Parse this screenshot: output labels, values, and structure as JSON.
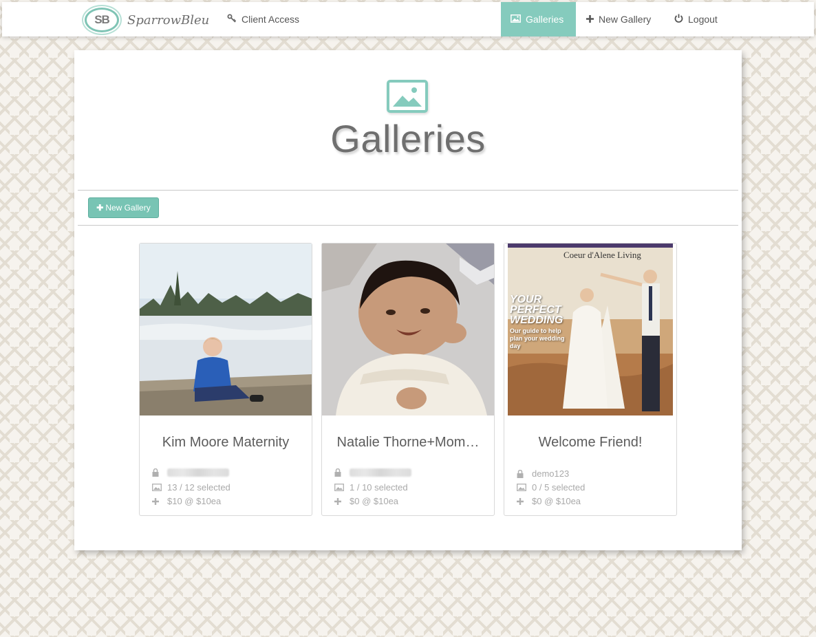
{
  "brand": {
    "initials": "SB",
    "name": "SparrowBleu"
  },
  "nav": {
    "client_access": "Client Access",
    "galleries": "Galleries",
    "new_gallery": "New Gallery",
    "logout": "Logout"
  },
  "page": {
    "title": "Galleries",
    "new_gallery_button": "New Gallery"
  },
  "colors": {
    "accent": "#85cbbd",
    "text": "#5c5c5c",
    "muted": "#a9a9a9"
  },
  "icons": {
    "client_access": "key-icon",
    "galleries": "picture-icon",
    "new_gallery": "plus-icon",
    "logout": "power-icon",
    "password": "lock-icon",
    "selected": "picture-icon",
    "price": "plus-icon"
  },
  "galleries": [
    {
      "name": "Kim Moore Maternity",
      "password": "",
      "password_obscured": true,
      "selected": "13 / 12 selected",
      "price": "$10 @ $10ea"
    },
    {
      "name": "Natalie Thorne+Mom…",
      "password": "",
      "password_obscured": true,
      "selected": "1 / 10 selected",
      "price": "$0 @ $10ea"
    },
    {
      "name": "Welcome Friend!",
      "password": "demo123",
      "password_obscured": false,
      "selected": "0 / 5 selected",
      "price": "$0 @ $10ea"
    }
  ],
  "magazine_cover": {
    "masthead": "Coeur d'Alene Living",
    "headline_1": "YOUR",
    "headline_2": "PERFECT",
    "headline_3": "WEDDING",
    "subline": "Our guide to help plan your wedding day"
  }
}
